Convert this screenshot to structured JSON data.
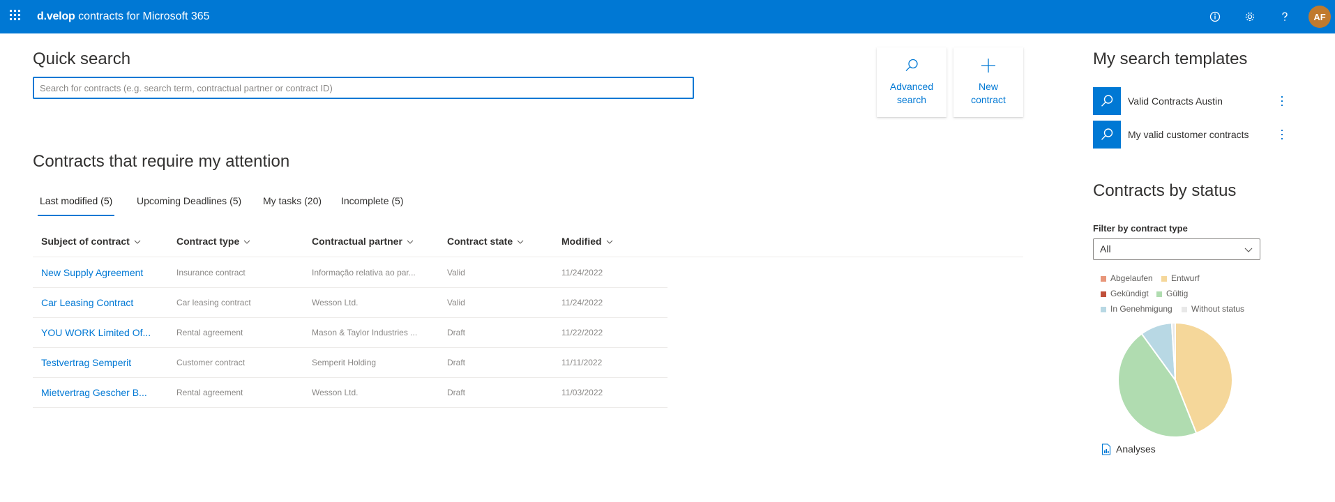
{
  "app": {
    "brand_logo": "d.velop",
    "brand_title": "contracts for Microsoft 365",
    "user_initials": "AF",
    "accent_color": "#0078d4",
    "icons": [
      "app-launcher-icon",
      "info-icon",
      "settings-gear-icon",
      "help-icon"
    ]
  },
  "quick_search": {
    "title": "Quick search",
    "placeholder": "Search for contracts (e.g. search term, contractual partner or contract ID)",
    "value": ""
  },
  "actions": {
    "advanced_search": [
      "Advanced",
      "search"
    ],
    "new_contract": [
      "New",
      "contract"
    ]
  },
  "attention": {
    "title": "Contracts that require my attention",
    "tabs": [
      {
        "label": "Last modified (5)",
        "active": true
      },
      {
        "label": "Upcoming Deadlines (5)",
        "active": false
      },
      {
        "label": "My tasks (20)",
        "active": false
      },
      {
        "label": "Incomplete (5)",
        "active": false
      }
    ],
    "columns": [
      "Subject of contract",
      "Contract type",
      "Contractual partner",
      "Contract state",
      "Modified"
    ],
    "rows": [
      {
        "subject": "New Supply Agreement",
        "type": "Insurance contract",
        "partner": "Informação relativa ao par...",
        "state": "Valid",
        "modified": "11/24/2022"
      },
      {
        "subject": "Car Leasing Contract",
        "type": "Car leasing contract",
        "partner": "Wesson Ltd.",
        "state": "Valid",
        "modified": "11/24/2022"
      },
      {
        "subject": "YOU WORK Limited Of...",
        "type": "Rental agreement",
        "partner": "Mason & Taylor Industries ...",
        "state": "Draft",
        "modified": "11/22/2022"
      },
      {
        "subject": "Testvertrag Semperit",
        "type": "Customer contract",
        "partner": "Semperit Holding",
        "state": "Draft",
        "modified": "11/11/2022"
      },
      {
        "subject": "Mietvertrag Gescher B...",
        "type": "Rental agreement",
        "partner": "Wesson Ltd.",
        "state": "Draft",
        "modified": "11/03/2022"
      }
    ]
  },
  "templates": {
    "title": "My search templates",
    "items": [
      {
        "name": "Valid Contracts Austin"
      },
      {
        "name": "My valid customer contracts"
      }
    ]
  },
  "status": {
    "title": "Contracts by status",
    "filter_label": "Filter by contract type",
    "filter_value": "All",
    "analyses_label": "Analyses"
  },
  "chart_data": {
    "type": "pie",
    "title": "",
    "legend_position": "top",
    "series": [
      {
        "name": "Abgelaufen",
        "value": 0,
        "color": "#e8967a"
      },
      {
        "name": "Entwurf",
        "value": 44,
        "color": "#f5d79a"
      },
      {
        "name": "Gekündigt",
        "value": 0,
        "color": "#c0503a"
      },
      {
        "name": "Gültig",
        "value": 46,
        "color": "#b0dcb0"
      },
      {
        "name": "In Genehmigung",
        "value": 9,
        "color": "#b8d8e4"
      },
      {
        "name": "Without status",
        "value": 1,
        "color": "#e8e8e8"
      }
    ]
  }
}
